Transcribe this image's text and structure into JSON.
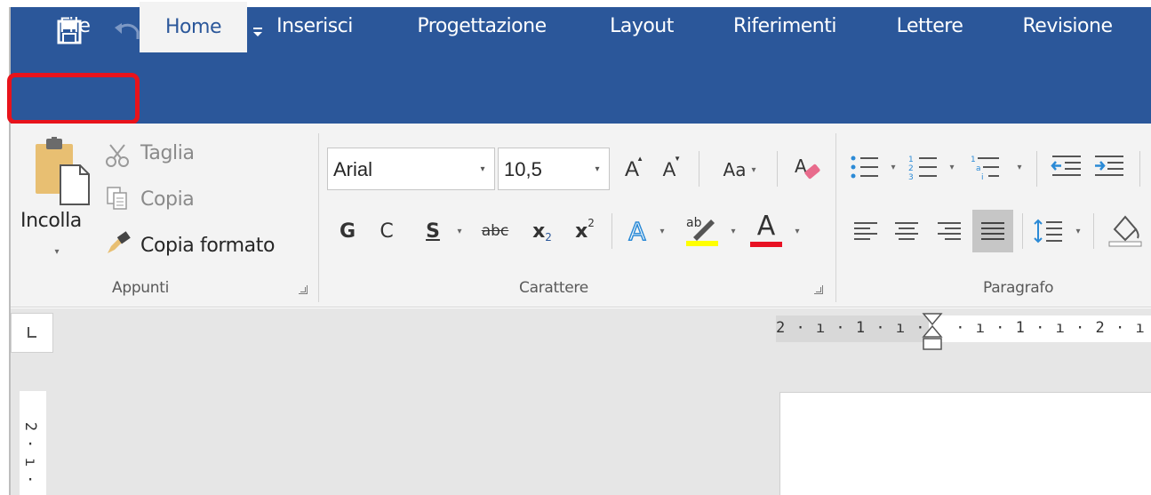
{
  "quick_access": {
    "save_icon": "save-icon",
    "undo_icon": "undo-icon",
    "redo_icon": "redo-icon",
    "customize_icon": "customize-qat-icon"
  },
  "tabs": [
    {
      "label": "File"
    },
    {
      "label": "Home"
    },
    {
      "label": "Inserisci"
    },
    {
      "label": "Progettazione"
    },
    {
      "label": "Layout"
    },
    {
      "label": "Riferimenti"
    },
    {
      "label": "Lettere"
    },
    {
      "label": "Revisione"
    }
  ],
  "active_tab": "Home",
  "highlighted_tab": "File",
  "clipboard": {
    "paste_label": "Incolla",
    "cut_label": "Taglia",
    "copy_label": "Copia",
    "format_painter_label": "Copia formato",
    "group_label": "Appunti"
  },
  "font": {
    "font_name": "Arial",
    "font_size": "10,5",
    "grow_icon": "A",
    "shrink_icon": "A",
    "case_label": "Aa",
    "bold": "G",
    "italic": "C",
    "underline": "S",
    "strikethrough": "abc",
    "subscript_base": "x",
    "subscript": "2",
    "superscript_base": "x",
    "superscript": "2",
    "text_effects": "A",
    "highlight": "ab",
    "font_color": "A",
    "group_label": "Carattere"
  },
  "paragraph": {
    "group_label": "Paragrafo"
  },
  "ruler": {
    "horizontal": "2 · ı · 1 · ı ·   · ı · 1 · ı · 2 · ı ·",
    "vertical": [
      "2",
      "·",
      "ı",
      "·"
    ]
  },
  "colors": {
    "brand": "#2b579a",
    "ribbon": "#f3f3f3",
    "highlight_border": "#e8131b",
    "highlight_yellow": "#ffff00",
    "font_red": "#e81123"
  }
}
